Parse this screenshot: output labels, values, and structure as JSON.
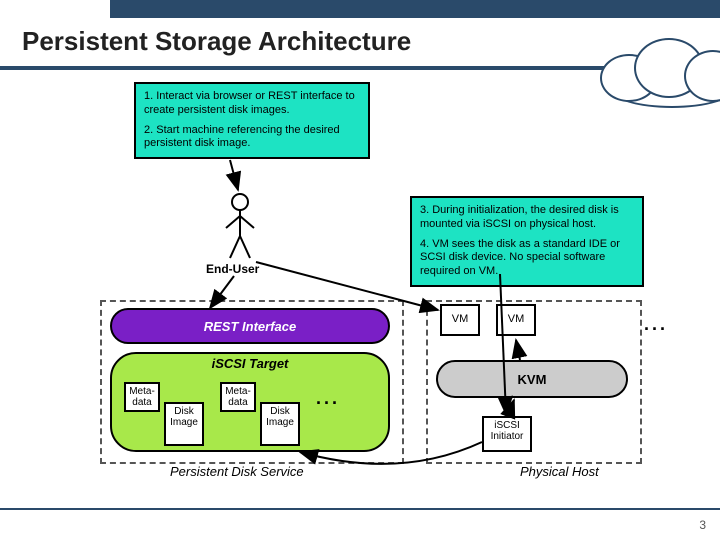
{
  "title": "Persistent Storage Architecture",
  "page_number": "3",
  "info_left": {
    "step1": "1. Interact via browser or REST interface to create persistent disk images.",
    "step2": "2. Start machine referencing the desired persistent disk image."
  },
  "info_right": {
    "step3": "3. During initialization, the desired disk is mounted via iSCSI on physical host.",
    "step4": "4. VM sees the disk as a standard IDE or SCSI disk device. No special software required on VM."
  },
  "actors": {
    "end_user": "End-User"
  },
  "components": {
    "rest_interface": "REST Interface",
    "iscsi_target": "iSCSI Target",
    "kvm": "KVM",
    "vm": "VM",
    "metadata": "Meta-data",
    "disk_image": "Disk Image",
    "iscsi_initiator": "iSCSI Initiator"
  },
  "zones": {
    "persistent_disk_service": "Persistent Disk Service",
    "physical_host": "Physical Host"
  },
  "ellipsis": "..."
}
